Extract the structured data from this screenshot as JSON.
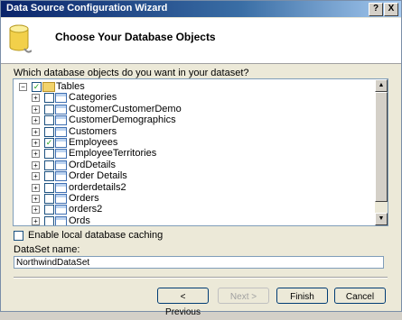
{
  "window": {
    "title": "Data Source Configuration Wizard",
    "help_button": "?",
    "close_button": "X"
  },
  "header": {
    "title": "Choose Your Database Objects"
  },
  "question": "Which database objects do you want in your dataset?",
  "tree": {
    "root": {
      "label": "Tables",
      "checked": true
    },
    "items": [
      {
        "label": "Categories",
        "checked": false
      },
      {
        "label": "CustomerCustomerDemo",
        "checked": false
      },
      {
        "label": "CustomerDemographics",
        "checked": false
      },
      {
        "label": "Customers",
        "checked": false
      },
      {
        "label": "Employees",
        "checked": true
      },
      {
        "label": "EmployeeTerritories",
        "checked": false
      },
      {
        "label": "OrdDetails",
        "checked": false
      },
      {
        "label": "Order Details",
        "checked": false
      },
      {
        "label": "orderdetails2",
        "checked": false
      },
      {
        "label": "Orders",
        "checked": false
      },
      {
        "label": "orders2",
        "checked": false
      },
      {
        "label": "Ords",
        "checked": false
      }
    ]
  },
  "caching": {
    "label": "Enable local database caching",
    "checked": false
  },
  "dataset": {
    "label": "DataSet name:",
    "value": "NorthwindDataSet"
  },
  "buttons": {
    "previous": "< Previous",
    "next": "Next >",
    "finish": "Finish",
    "cancel": "Cancel"
  }
}
